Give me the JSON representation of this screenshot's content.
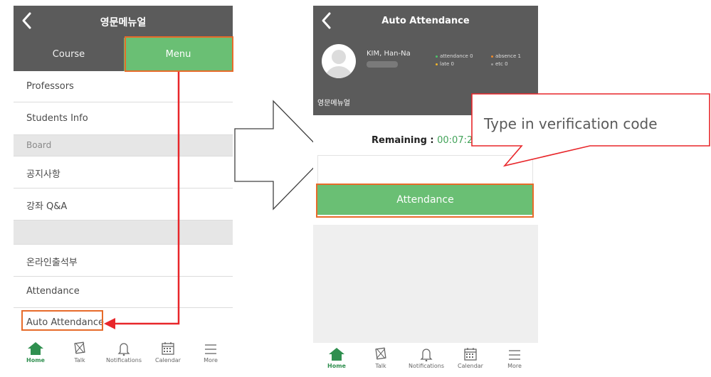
{
  "left": {
    "title": "영문메뉴얼",
    "tabs": {
      "course": "Course",
      "menu": "Menu"
    },
    "rows": [
      {
        "label": "Professors",
        "type": "item"
      },
      {
        "label": "Students Info",
        "type": "item"
      },
      {
        "label": "Board",
        "type": "header"
      },
      {
        "label": "공지사항",
        "type": "item"
      },
      {
        "label": "강좌 Q&A",
        "type": "item"
      },
      {
        "label": "",
        "type": "header"
      },
      {
        "label": "온라인출석부",
        "type": "item"
      },
      {
        "label": "Attendance",
        "type": "item"
      },
      {
        "label": "Auto Attendance",
        "type": "item"
      }
    ]
  },
  "nav": {
    "home": "Home",
    "talk": "Talk",
    "notifications": "Notifications",
    "calendar": "Calendar",
    "more": "More"
  },
  "right": {
    "title": "Auto Attendance",
    "name": "KIM, Han-Na",
    "stats": {
      "attendance": "attendance 0",
      "absence": "absence 1",
      "late": "late 0",
      "etc": "etc 0"
    },
    "course": "영문메뉴얼",
    "remaining_label": "Remaining : ",
    "remaining_value": "00:07:2",
    "button": "Attendance"
  },
  "callout": {
    "text": "Type in verification code"
  },
  "colors": {
    "header_bg": "#5b5b5b",
    "accent_green": "#6abf74",
    "highlight_orange": "#e76b2a",
    "arrow_red": "#e8262a",
    "dot_green": "#4cc36a",
    "dot_orange": "#f08a2a"
  },
  "icons": {
    "back": "chevron-left-icon",
    "home": "home-icon",
    "talk": "talk-icon",
    "notifications": "bell-icon",
    "calendar": "calendar-icon",
    "more": "menu-icon"
  }
}
